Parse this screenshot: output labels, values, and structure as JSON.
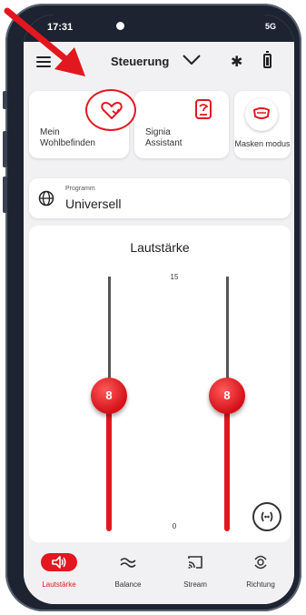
{
  "status_bar": {
    "time": "17:31",
    "network": "5G"
  },
  "header": {
    "title": "Steuerung"
  },
  "shortcuts": [
    {
      "label": "Mein Wohlbefinden",
      "icon": "heart-icon"
    },
    {
      "label": "Signia Assistant",
      "icon": "assistant-icon"
    },
    {
      "label": "Masken modus",
      "icon": "mask-icon"
    }
  ],
  "program": {
    "caption": "Programm",
    "value": "Universell"
  },
  "volume": {
    "title": "Lautstärke",
    "max_label": "15",
    "min_label": "0",
    "min": 0,
    "max": 15,
    "left_value": "8",
    "right_value": "8"
  },
  "nav": [
    {
      "label": "Lautstärke",
      "icon": "speaker-icon",
      "active": true
    },
    {
      "label": "Balance",
      "icon": "balance-icon",
      "active": false
    },
    {
      "label": "Stream",
      "icon": "cast-icon",
      "active": false
    },
    {
      "label": "Richtung",
      "icon": "direction-icon",
      "active": false
    }
  ],
  "colors": {
    "accent": "#e3171f",
    "frame": "#1d2330",
    "background": "#f1f1f3"
  }
}
